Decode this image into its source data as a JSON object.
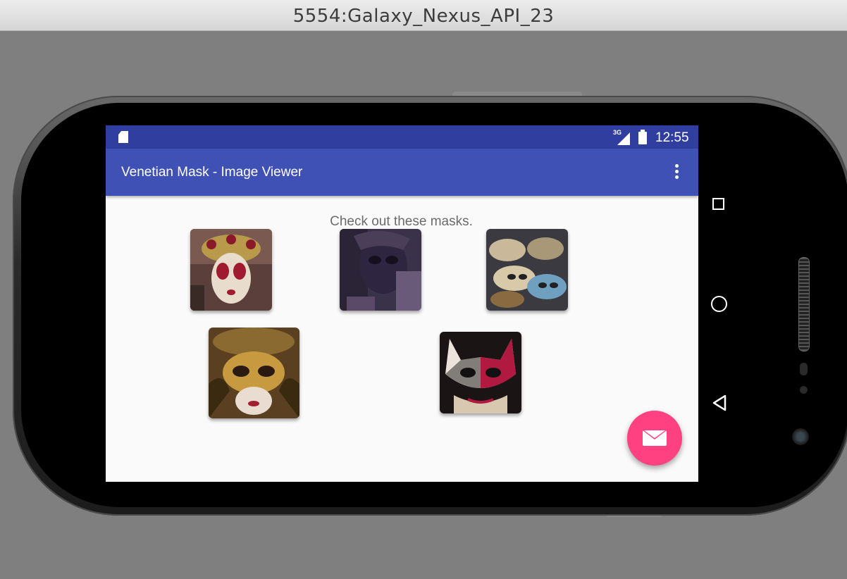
{
  "window": {
    "title": "5554:Galaxy_Nexus_API_23"
  },
  "status_bar": {
    "network": "3G",
    "time": "12:55"
  },
  "app_bar": {
    "title": "Venetian Mask - Image Viewer"
  },
  "content": {
    "caption": "Check out these masks.",
    "images": [
      "mask-image-1",
      "mask-image-2",
      "mask-image-3",
      "mask-image-4",
      "mask-image-5"
    ]
  },
  "colors": {
    "status_bar": "#303f9f",
    "app_bar": "#3f51b5",
    "fab": "#ff4081"
  },
  "icons": {
    "fab": "email-icon",
    "overflow": "more-vert-icon",
    "nav_back": "back-icon",
    "nav_home": "home-icon",
    "nav_recents": "recents-icon"
  }
}
